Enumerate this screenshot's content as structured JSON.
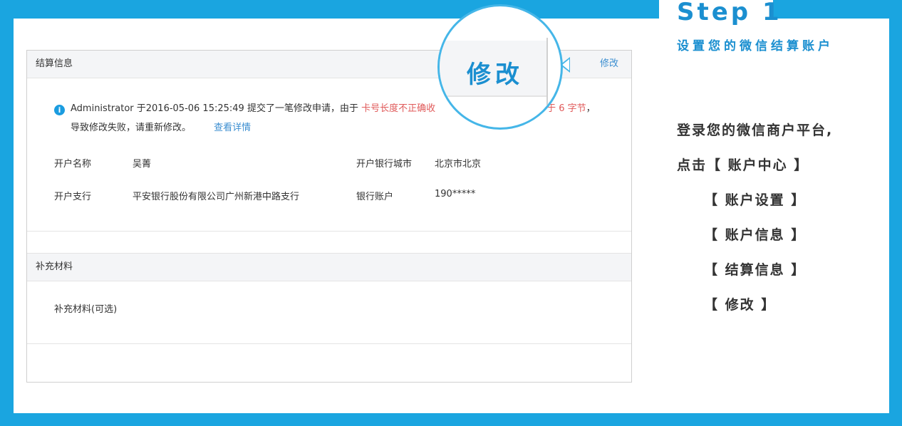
{
  "step": {
    "title": "Step 1",
    "subtitle": "设置您的微信结算账户"
  },
  "instructions": [
    "登录您的微信商户平台,",
    "点击【 账户中心 】",
    "【 账户设置 】",
    "【 账户信息 】",
    "【 结算信息 】",
    "【 修改 】"
  ],
  "panel": {
    "title": "结算信息",
    "edit_label": "修改",
    "notice": {
      "text1": "Administrator 于2016-05-06 15:25:49 提交了一笔修改申请，由于 ",
      "red1": "卡号长度不正确收",
      "red2": "得少于 6 字节",
      "text2": "，",
      "line2": "导致修改失败，请重新修改。",
      "link": "查看详情"
    },
    "fields": [
      {
        "label": "开户名称",
        "value": "吴菁"
      },
      {
        "label": "开户银行城市",
        "value": "北京市北京"
      },
      {
        "label": "开户支行",
        "value": "平安银行股份有限公司广州新港中路支行"
      },
      {
        "label": "银行账户",
        "value": "190*****"
      }
    ],
    "supplement": {
      "title": "补充材料",
      "item": "补充材料(可选)"
    }
  },
  "magnifier": {
    "label": "修改"
  },
  "colors": {
    "frame": "#1aa5e0",
    "accent": "#1b8fd0",
    "error": "#e05a5a",
    "link": "#3b8ed0"
  }
}
